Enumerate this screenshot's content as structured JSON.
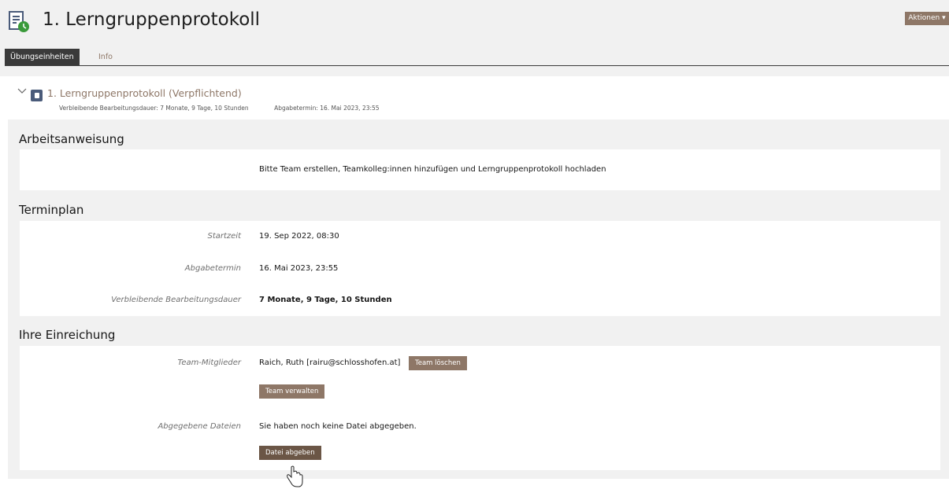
{
  "header": {
    "title": "1. Lerngruppenprotokoll",
    "actions_label": "Aktionen ▾",
    "icon": "document-clock-icon"
  },
  "tabs": [
    {
      "label": "Übungseinheiten",
      "active": true
    },
    {
      "label": "Info",
      "active": false
    }
  ],
  "assignment": {
    "title": "1. Lerngruppenprotokoll (Verpflichtend)",
    "remaining": "Verbleibende Bearbeitungsdauer: 7 Monate, 9 Tage, 10 Stunden",
    "deadline": "Abgabetermin: 16. Mai 2023, 23:55"
  },
  "instructions": {
    "heading": "Arbeitsanweisung",
    "text": "Bitte Team erstellen, Teamkolleg:innen hinzufügen und Lerngruppenprotokoll hochladen"
  },
  "schedule": {
    "heading": "Terminplan",
    "rows": [
      {
        "label": "Startzeit",
        "value": "19. Sep 2022, 08:30"
      },
      {
        "label": "Abgabetermin",
        "value": "16. Mai 2023, 23:55"
      },
      {
        "label": "Verbleibende Bearbeitungsdauer",
        "value": "7 Monate, 9 Tage, 10 Stunden"
      }
    ]
  },
  "submission": {
    "heading": "Ihre Einreichung",
    "team_label": "Team-Mitglieder",
    "team_member": "Raich, Ruth [rairu@schlosshofen.at]",
    "delete_team_button": "Team löschen",
    "manage_team_button": "Team verwalten",
    "files_label": "Abgegebene Dateien",
    "files_value": "Sie haben noch keine Datei abgegeben.",
    "submit_file_button": "Datei abgeben"
  },
  "colors": {
    "accent": "#8e7767",
    "accent_dark": "#6b5646",
    "tab_active": "#3a3a3a",
    "background": "#f1f1f1"
  }
}
